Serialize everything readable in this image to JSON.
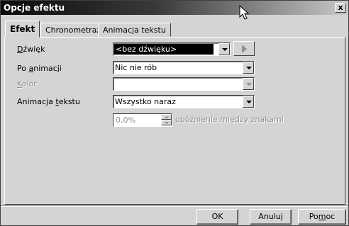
{
  "window": {
    "title": "Opcje efektu"
  },
  "tabs": [
    {
      "label": "Efekt",
      "active": true
    },
    {
      "label": "Chronometraż",
      "active": false
    },
    {
      "label": "Animacja tekstu",
      "active": false
    }
  ],
  "form": {
    "sound": {
      "label_pre": "",
      "label_u": "D",
      "label_post": "źwięk",
      "value": "<bez dźwięku>"
    },
    "after_animation": {
      "label_pre": "Po ",
      "label_u": "a",
      "label_post": "nimacji",
      "value": "Nic nie rób"
    },
    "color": {
      "label_pre": "",
      "label_u": "K",
      "label_post": "olor",
      "value": ""
    },
    "text_animation": {
      "label_pre": "Animacja ",
      "label_u": "t",
      "label_post": "ekstu",
      "value": "Wszystko naraz"
    },
    "delay": {
      "value": "0,0%",
      "label": "opóźnienie między znakami"
    }
  },
  "buttons": {
    "ok": "OK",
    "cancel": "Anuluj",
    "help_pre": "Po",
    "help_u": "m",
    "help_post": "oc"
  },
  "close_glyph": "x"
}
